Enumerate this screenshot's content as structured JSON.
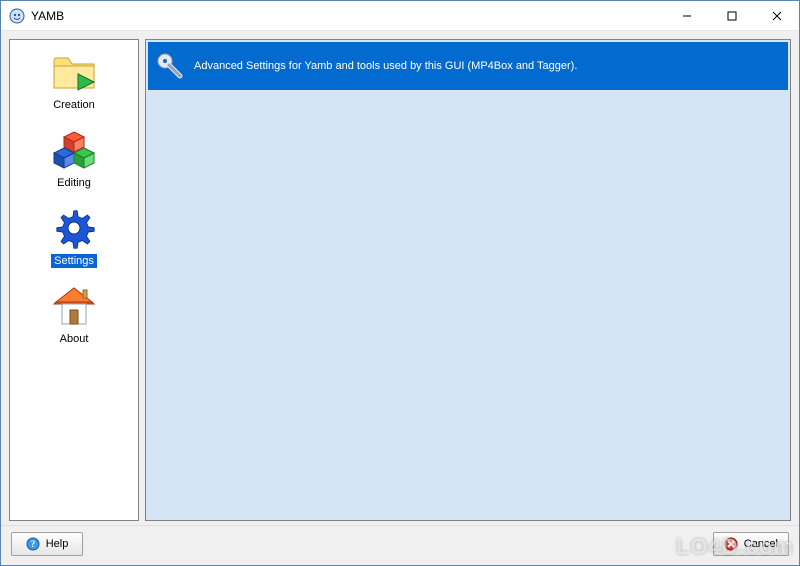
{
  "window": {
    "title": "YAMB",
    "buttons": {
      "minimize": "–",
      "maximize": "☐",
      "close": "✕"
    }
  },
  "sidebar": {
    "items": [
      {
        "label": "Creation",
        "icon": "folder-play-icon",
        "selected": false
      },
      {
        "label": "Editing",
        "icon": "cubes-icon",
        "selected": false
      },
      {
        "label": "Settings",
        "icon": "gear-icon",
        "selected": true
      },
      {
        "label": "About",
        "icon": "home-icon",
        "selected": false
      }
    ]
  },
  "content": {
    "banner_text": "Advanced Settings for Yamb and tools used by this GUI (MP4Box and Tagger).",
    "banner_icon": "wrench-icon"
  },
  "footer": {
    "help_label": "Help",
    "cancel_label": "Cancel"
  },
  "watermark": "LO4D.com"
}
